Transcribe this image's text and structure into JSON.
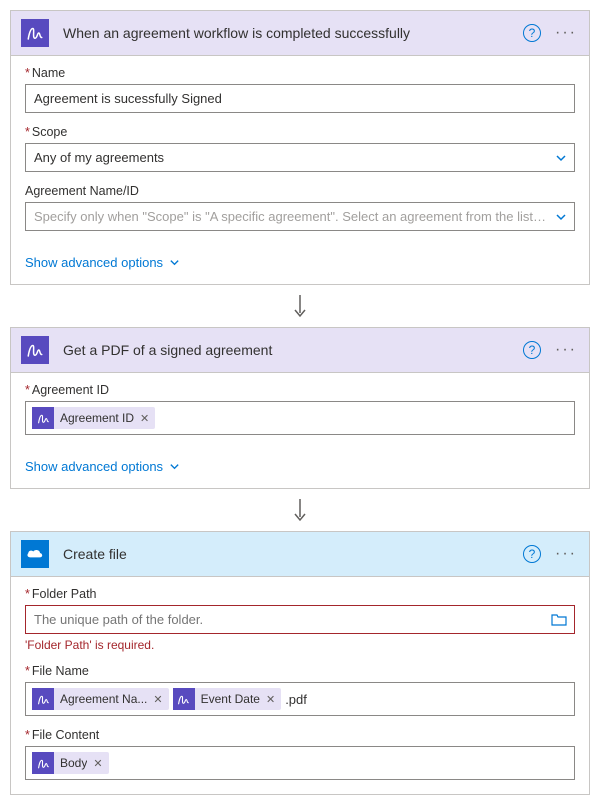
{
  "cards": [
    {
      "title": "When an agreement workflow is completed successfully",
      "fields": {
        "name": {
          "label": "Name",
          "value": "Agreement is sucessfully Signed"
        },
        "scope": {
          "label": "Scope",
          "value": "Any of my agreements"
        },
        "agreement": {
          "label": "Agreement Name/ID",
          "placeholder": "Specify only when \"Scope\" is \"A specific agreement\". Select an agreement from the list or enter th"
        }
      },
      "show_advanced": "Show advanced options"
    },
    {
      "title": "Get a PDF of a signed agreement",
      "fields": {
        "agreement_id": {
          "label": "Agreement ID",
          "token": "Agreement ID"
        }
      },
      "show_advanced": "Show advanced options"
    },
    {
      "title": "Create file",
      "fields": {
        "folder_path": {
          "label": "Folder Path",
          "placeholder": "The unique path of the folder.",
          "error": "'Folder Path' is required."
        },
        "file_name": {
          "label": "File Name",
          "tokens": [
            "Agreement Na...",
            "Event Date"
          ],
          "suffix": ".pdf"
        },
        "file_content": {
          "label": "File Content",
          "token": "Body"
        }
      }
    }
  ]
}
